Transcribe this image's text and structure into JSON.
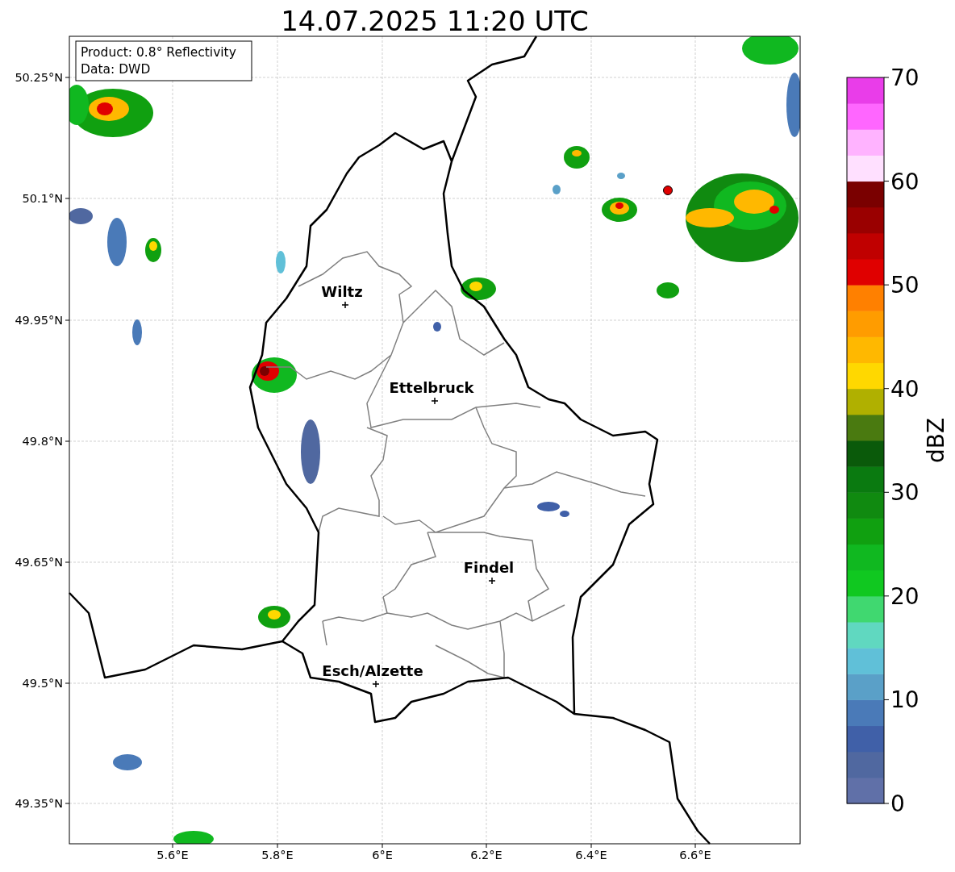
{
  "title": "14.07.2025 11:20 UTC",
  "info_box": [
    "Product: 0.8° Reflectivity",
    "Data: DWD"
  ],
  "map": {
    "cities": [
      {
        "name": "Wiltz"
      },
      {
        "name": "Ettelbruck"
      },
      {
        "name": "Findel"
      },
      {
        "name": "Esch/Alzette"
      }
    ],
    "yticks": [
      "50.25°N",
      "50.1°N",
      "49.95°N",
      "49.8°N",
      "49.65°N",
      "49.5°N",
      "49.35°N"
    ],
    "xticks": [
      "5.6°E",
      "5.8°E",
      "6°E",
      "6.2°E",
      "6.4°E",
      "6.6°E"
    ]
  },
  "colorbar": {
    "label": "dBZ",
    "ticks": [
      "70",
      "60",
      "50",
      "40",
      "30",
      "20",
      "10",
      "0"
    ],
    "bands": [
      {
        "color": "#6070a8"
      },
      {
        "color": "#5068a0"
      },
      {
        "color": "#4060a8"
      },
      {
        "color": "#4a7ab8"
      },
      {
        "color": "#5aa0c8"
      },
      {
        "color": "#60c0d8"
      },
      {
        "color": "#60d8c0"
      },
      {
        "color": "#40d870"
      },
      {
        "color": "#10c820"
      },
      {
        "color": "#10b820"
      },
      {
        "color": "#10a010"
      },
      {
        "color": "#108a10"
      },
      {
        "color": "#0a7a10"
      },
      {
        "color": "#0a5a0a"
      },
      {
        "color": "#4a7a10"
      },
      {
        "color": "#b0b000"
      },
      {
        "color": "#ffd800"
      },
      {
        "color": "#ffb800"
      },
      {
        "color": "#ff9c00"
      },
      {
        "color": "#ff8000"
      },
      {
        "color": "#e00000"
      },
      {
        "color": "#c00000"
      },
      {
        "color": "#9a0000"
      },
      {
        "color": "#7a0000"
      },
      {
        "color": "#ffe0ff"
      },
      {
        "color": "#ffb3ff"
      },
      {
        "color": "#ff66ff"
      },
      {
        "color": "#e93de9"
      }
    ]
  }
}
